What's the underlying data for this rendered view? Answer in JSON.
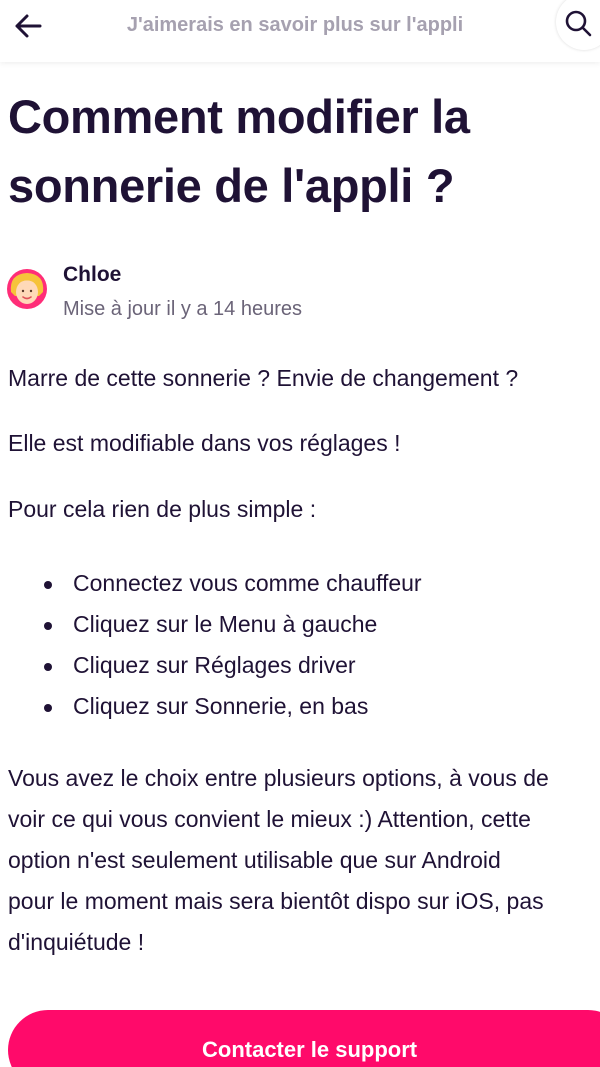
{
  "header": {
    "back_icon": "arrow-left-icon",
    "title": "J'aimerais en savoir plus sur l'appli",
    "search_icon": "search-icon"
  },
  "article": {
    "title_line1": "Comment modifier la",
    "title_line2": "sonnerie de l'appli ?",
    "author": {
      "name": "Chloe",
      "updated": "Mise à jour il y a 14 heures",
      "avatar_icon": "avatar"
    },
    "paragraphs": [
      "Marre de cette sonnerie ? Envie de changement ?",
      "Elle est modifiable dans vos réglages !",
      "Pour cela rien de plus simple :"
    ],
    "steps": [
      "Connectez vous comme chauffeur",
      "Cliquez sur le Menu à gauche",
      "Cliquez sur Réglages driver",
      "Cliquez sur Sonnerie, en bas"
    ],
    "closing_lines": [
      "Vous avez le choix entre plusieurs options, à vous de",
      "voir ce qui vous convient le mieux :) Attention, cette",
      "option n'est seulement utilisable que sur Android",
      "pour le moment mais sera bientôt dispo sur iOS, pas",
      "d'inquiétude !"
    ]
  },
  "footer": {
    "contact_label": "Contacter le support"
  },
  "colors": {
    "text": "#1f1235",
    "header_title": "#a6a1b0",
    "meta": "#6b6478",
    "accent": "#ff0a6a"
  }
}
